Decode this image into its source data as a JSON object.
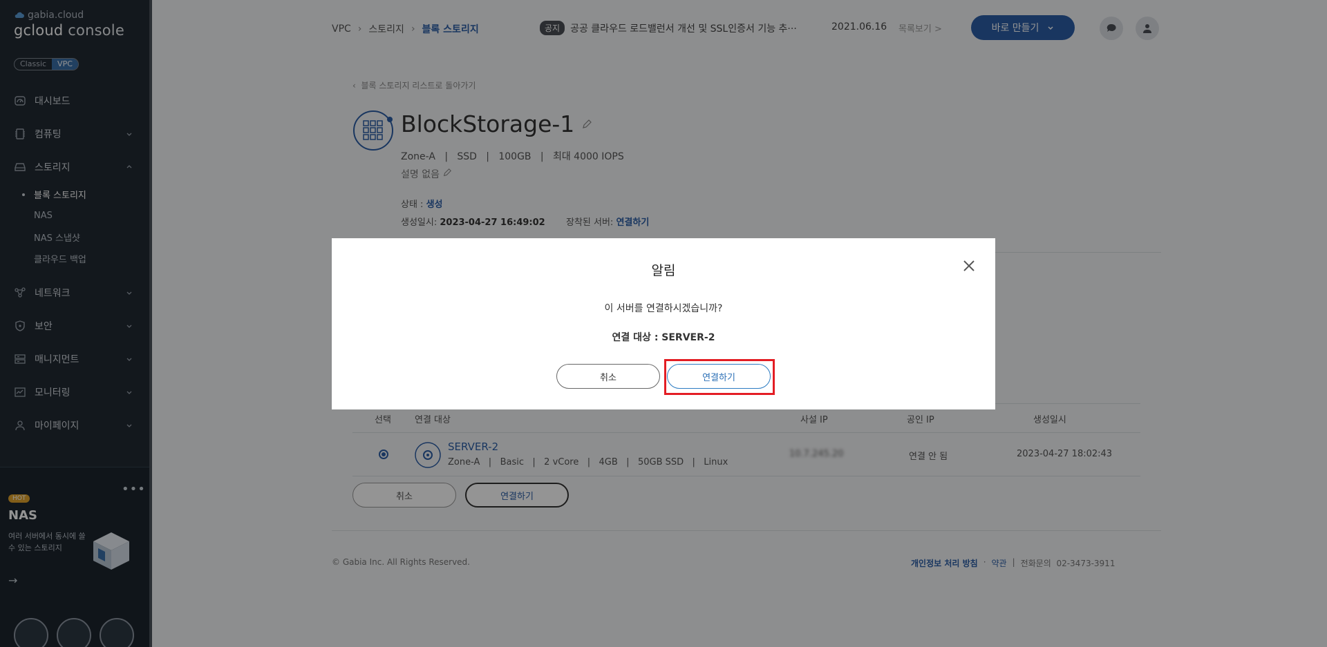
{
  "brand": {
    "top": "gabia.cloud",
    "main_prefix": "gcloud",
    "main_suffix": "console"
  },
  "mode_toggle": {
    "classic": "Classic",
    "vpc": "VPC"
  },
  "sidebar": {
    "items": [
      {
        "label": "대시보드",
        "icon": "dashboard-icon"
      },
      {
        "label": "컴퓨팅",
        "icon": "chip-icon"
      },
      {
        "label": "스토리지",
        "icon": "storage-icon"
      },
      {
        "label": "네트워크",
        "icon": "network-icon"
      },
      {
        "label": "보안",
        "icon": "shield-icon"
      },
      {
        "label": "매니지먼트",
        "icon": "management-icon"
      },
      {
        "label": "모니터링",
        "icon": "monitor-icon"
      },
      {
        "label": "마이페이지",
        "icon": "user-icon"
      }
    ],
    "storage_sub": [
      "블록 스토리지",
      "NAS",
      "NAS 스냅샷",
      "클라우드 백업"
    ]
  },
  "promo": {
    "badge": "HOT",
    "title": "NAS",
    "desc": "여러 서버에서 동시에 쓸 수 있는 스토리지",
    "arrow": "→"
  },
  "breadcrumb": [
    "VPC",
    "스토리지",
    "블록 스토리지"
  ],
  "notice": {
    "badge": "공지",
    "text": "공공 클라우드 로드밸런서 개선 및 SSL인증서 기능 추···",
    "date": "2021.06.16",
    "more": "목록보기 >"
  },
  "quick_create_label": "바로 만들기",
  "back_link": "블록 스토리지 리스트로 돌아가기",
  "storage": {
    "name": "BlockStorage-1",
    "specs": "Zone-A   |   SSD   |   100GB   |   최대 4000 IOPS",
    "description": "설명 없음",
    "status_label": "상태 : ",
    "status_value": "생성",
    "created_label": "생성일시: ",
    "created_value": "2023-04-27 16:49:02",
    "attached_label": "장착된 서버: ",
    "attached_value": "연결하기"
  },
  "table": {
    "headers": [
      "선택",
      "연결 대상",
      "사설 IP",
      "공인 IP",
      "생성일시"
    ],
    "row": {
      "name": "SERVER-2",
      "specs": "Zone-A   |   Basic   |   2 vCore   |   4GB   |   50GB SSD   |   Linux",
      "private_ip": "10.7.245.20",
      "public_ip": "연결 안 됨",
      "created": "2023-04-27 18:02:43"
    }
  },
  "page_buttons": {
    "cancel": "취소",
    "connect": "연결하기"
  },
  "footer": {
    "copyright": "© Gabia Inc. All Rights Reserved.",
    "privacy": "개인정보 처리 방침",
    "dot": "·",
    "terms": "약관",
    "bar": "|",
    "phone": "전화문의  02-3473-3911"
  },
  "modal": {
    "title": "알림",
    "message": "이 서버를 연결하시겠습니까?",
    "target": "연결 대상 : SERVER-2",
    "cancel": "취소",
    "confirm": "연결하기"
  },
  "colors": {
    "accent": "#2b5ea6",
    "sidebar_bg": "#222a33",
    "highlight": "#e31d24"
  }
}
